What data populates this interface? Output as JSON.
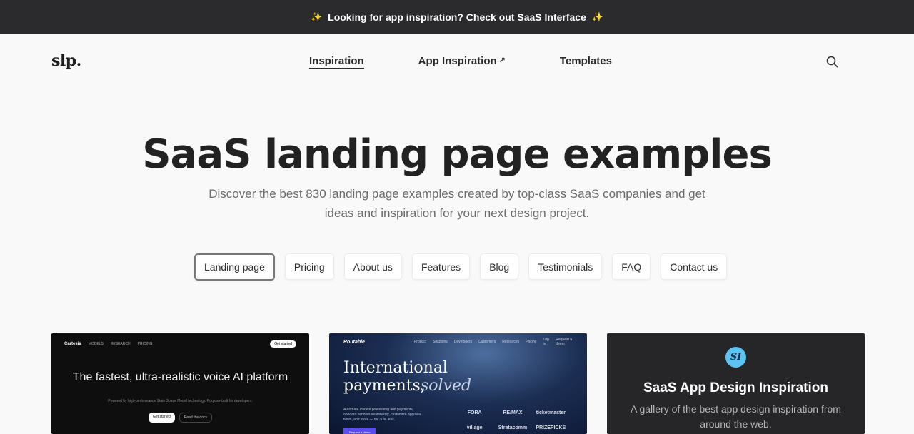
{
  "banner": {
    "spark_left": "✨",
    "text": "Looking for app inspiration? Check out SaaS Interface",
    "spark_right": "✨"
  },
  "header": {
    "logo": "slp.",
    "nav": [
      {
        "label": "Inspiration"
      },
      {
        "label": "App Inspiration",
        "arrow": "↗"
      },
      {
        "label": "Templates"
      }
    ],
    "search_icon": "search-icon"
  },
  "hero": {
    "title": "SaaS landing page examples",
    "subtitle": "Discover the best 830 landing page examples created by top-class SaaS companies and get ideas and inspiration for your next design project."
  },
  "filters": [
    "Landing page",
    "Pricing",
    "About us",
    "Features",
    "Blog",
    "Testimonials",
    "FAQ",
    "Contact us"
  ],
  "cards": [
    {
      "brand": "Cartesia",
      "nav": [
        "MODELS",
        "RESEARCH",
        "PRICING"
      ],
      "cta": "Get started",
      "title": "The fastest, ultra-realistic voice AI platform",
      "subtitle": "Powered by high-performance State Space Model technology. Purpose-built for developers.",
      "buttons": [
        "Get started",
        "Read the docs"
      ]
    },
    {
      "brand": "Routable",
      "nav": [
        "Product",
        "Solutions",
        "Developers",
        "Customers",
        "Resources",
        "Pricing",
        "Log in",
        "Request a demo"
      ],
      "title_main": "International payments,",
      "title_italic": "solved",
      "subtitle": "Automate invoice processing and payments, onboard vendors seamlessly, customize approval flows, and more — for 30% less.",
      "button": "Request a demo",
      "logos": [
        "FORA",
        "RE/MAX",
        "ticketmaster",
        "village",
        "Stratacomm",
        "PRIZEPICKS"
      ]
    },
    {
      "logo_text": "SI",
      "title": "SaaS App Design Inspiration",
      "text": "A gallery of the best app design inspiration from around the web."
    }
  ],
  "colors": {
    "banner_bg": "#2b2b2e",
    "page_bg": "#f9f9f9",
    "accent_purple": "#5a4bf4",
    "logo_blue": "#5cc3f2"
  }
}
